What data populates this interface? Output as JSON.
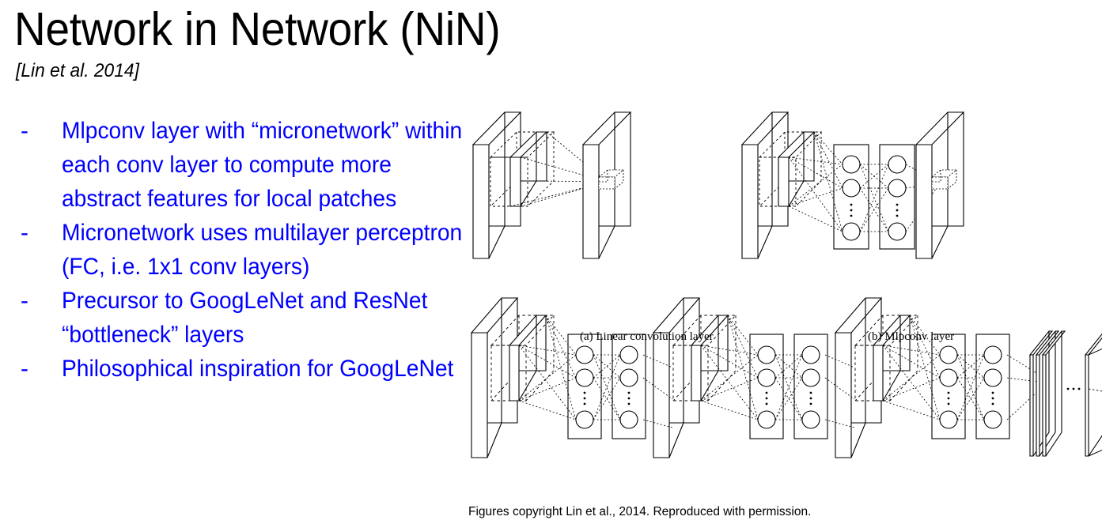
{
  "slide": {
    "title": "Network in Network (NiN)",
    "subtitle": "[Lin et al. 2014]",
    "bullet_marker": "-",
    "text_color": "#0000ff",
    "title_color": "#000000",
    "background": "#ffffff"
  },
  "bullets": [
    {
      "marker": "-",
      "text": "Mlpconv layer with “micronetwork” within each conv layer to compute more abstract features for local patches"
    },
    {
      "marker": "-",
      "text": "Micronetwork uses multilayer perceptron (FC, i.e. 1x1 conv layers)"
    },
    {
      "marker": "-",
      "text": "Precursor to GoogLeNet and ResNet “bottleneck” layers"
    },
    {
      "marker": "-",
      "text": "Philosophical inspiration for GoogLeNet"
    }
  ],
  "figures": {
    "caption_a": "(a) Linear convolution layer",
    "caption_b": "(b) Mlpconv layer",
    "credit": "Figures copyright Lin et al., 2014. Reproduced with permission.",
    "line_color": "#000000",
    "shade_color": "#9a9a9a"
  }
}
